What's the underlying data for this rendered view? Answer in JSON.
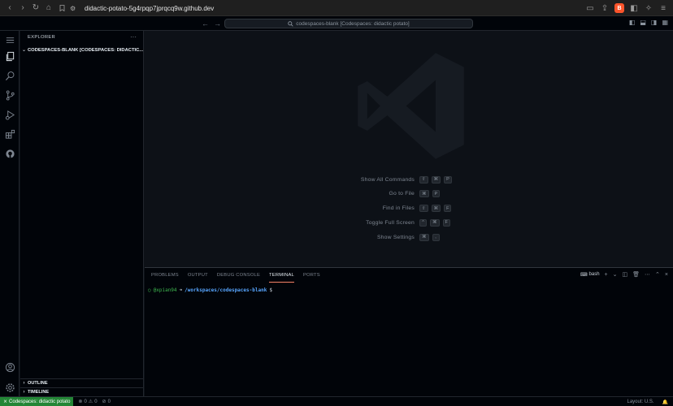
{
  "browser": {
    "url": "didactic-potato-5g4rpqp7jprqcq9w.github.dev",
    "brave_label": "B"
  },
  "titlebar": {
    "command_center": "codespaces-blank [Codespaces: didactic potato]"
  },
  "sidebar": {
    "title": "EXPLORER",
    "more": "···",
    "workspace": "CODESPACES-BLANK [CODESPACES: DIDACTIC...",
    "outline": "OUTLINE",
    "timeline": "TIMELINE"
  },
  "shortcuts": [
    {
      "label": "Show All Commands",
      "keys": [
        "⇧",
        "⌘",
        "P"
      ]
    },
    {
      "label": "Go to File",
      "keys": [
        "⌘",
        "P"
      ]
    },
    {
      "label": "Find in Files",
      "keys": [
        "⇧",
        "⌘",
        "F"
      ]
    },
    {
      "label": "Toggle Full Screen",
      "keys": [
        "^",
        "⌘",
        "F"
      ]
    },
    {
      "label": "Show Settings",
      "keys": [
        "⌘",
        ","
      ]
    }
  ],
  "panel": {
    "tabs": [
      "PROBLEMS",
      "OUTPUT",
      "DEBUG CONSOLE",
      "TERMINAL",
      "PORTS"
    ],
    "active_tab": "TERMINAL",
    "shell": "bash"
  },
  "terminal": {
    "user": "@xpian94",
    "arrow": "➜",
    "path": "/workspaces/codespaces-blank",
    "prompt": "$"
  },
  "statusbar": {
    "remote": "Codespaces: didactic potato",
    "errors": "0",
    "warnings": "0",
    "ports": "0",
    "layout": "Layout: U.S."
  },
  "colors": {
    "accent_tab": "#f78166",
    "remote_bg": "#238636",
    "terminal_green": "#3fb950",
    "terminal_path": "#58a6ff"
  }
}
